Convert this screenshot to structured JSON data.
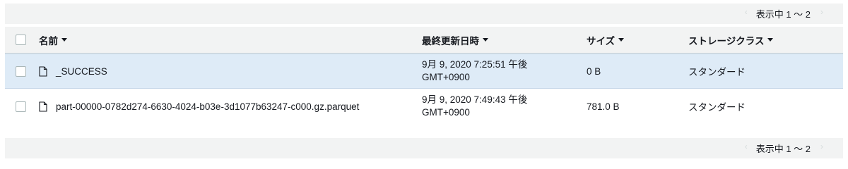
{
  "pagination": {
    "label": "表示中 1 ～ 2"
  },
  "table": {
    "headers": {
      "name": "名前",
      "last_modified": "最終更新日時",
      "size": "サイズ",
      "storage_class": "ストレージクラス"
    },
    "rows": [
      {
        "name": "_SUCCESS",
        "last_modified_line1": "9月 9, 2020 7:25:51 午後",
        "last_modified_line2": "GMT+0900",
        "size": "0 B",
        "storage_class": "スタンダード",
        "selected": true
      },
      {
        "name": "part-00000-0782d274-6630-4024-b03e-3d1077b63247-c000.gz.parquet",
        "last_modified_line1": "9月 9, 2020 7:49:43 午後",
        "last_modified_line2": "GMT+0900",
        "size": "781.0 B",
        "storage_class": "スタンダード",
        "selected": false
      }
    ]
  },
  "colors": {
    "selected_row": "#deebf7",
    "header_bg": "#f2f3f3",
    "text": "#16191f"
  }
}
